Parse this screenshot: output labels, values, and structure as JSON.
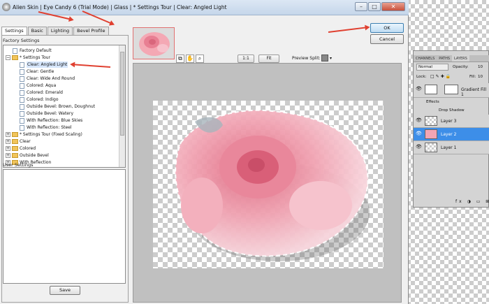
{
  "window": {
    "title": "Alien Skin | Eye Candy 6 (Trial Mode) | Glass | * Settings Tour | Clear: Angled Light",
    "buttons": [
      "–",
      "□",
      "✕"
    ]
  },
  "tabs": [
    "Settings",
    "Basic",
    "Lighting",
    "Bevel Profile"
  ],
  "factory_settings_label": "Factory Settings",
  "tree": [
    {
      "label": "Factory Default",
      "indent": 1,
      "kind": "page"
    },
    {
      "label": "* Settings Tour",
      "indent": 0,
      "kind": "folder",
      "exp": "−"
    },
    {
      "label": "Clear: Angled Light",
      "indent": 2,
      "kind": "page",
      "selected": true
    },
    {
      "label": "Clear: Gentle",
      "indent": 2,
      "kind": "page"
    },
    {
      "label": "Clear: Wide And Round",
      "indent": 2,
      "kind": "page"
    },
    {
      "label": "Colored: Aqua",
      "indent": 2,
      "kind": "page"
    },
    {
      "label": "Colored: Emerald",
      "indent": 2,
      "kind": "page"
    },
    {
      "label": "Colored: Indigo",
      "indent": 2,
      "kind": "page"
    },
    {
      "label": "Outside Bevel: Brown, Doughnut",
      "indent": 2,
      "kind": "page"
    },
    {
      "label": "Outside Bevel: Watery",
      "indent": 2,
      "kind": "page"
    },
    {
      "label": "With Reflection: Blue Skies",
      "indent": 2,
      "kind": "page"
    },
    {
      "label": "With Reflection: Steel",
      "indent": 2,
      "kind": "page"
    },
    {
      "label": "* Settings Tour (Fixed Scaling)",
      "indent": 0,
      "kind": "folder",
      "exp": "+"
    },
    {
      "label": "Clear",
      "indent": 0,
      "kind": "folder",
      "exp": "+"
    },
    {
      "label": "Colored",
      "indent": 0,
      "kind": "folder",
      "exp": "+"
    },
    {
      "label": "Outside Bevel",
      "indent": 0,
      "kind": "folder",
      "exp": "+"
    },
    {
      "label": "With Reflection",
      "indent": 0,
      "kind": "folder",
      "exp": "+"
    }
  ],
  "user_settings_label": "User Settings",
  "save_label": "Save",
  "toolbar": {
    "zoom_1": "1:1",
    "zoom_fit": "Fit",
    "preview_split": "Preview Split:"
  },
  "ok_label": "OK",
  "cancel_label": "Cancel",
  "photoshop": {
    "tabs": [
      "CHANNELS",
      "PATHS",
      "LAYERS"
    ],
    "blend_mode": "Normal",
    "opacity_label": "Opacity:",
    "opacity_value": "10",
    "lock_label": "Lock:",
    "fill_label": "Fill:",
    "fill_value": "10",
    "effects_label": "Effects",
    "drop_shadow_label": "Drop Shadow",
    "layers": [
      {
        "name": "Gradient Fill 1",
        "selected": false
      },
      {
        "name": "Layer 3",
        "selected": false
      },
      {
        "name": "Layer 2",
        "selected": true
      },
      {
        "name": "Layer 1",
        "selected": false
      }
    ]
  },
  "colors": {
    "accent_red": "#e04030",
    "ps_selected": "#3d8ee8"
  }
}
